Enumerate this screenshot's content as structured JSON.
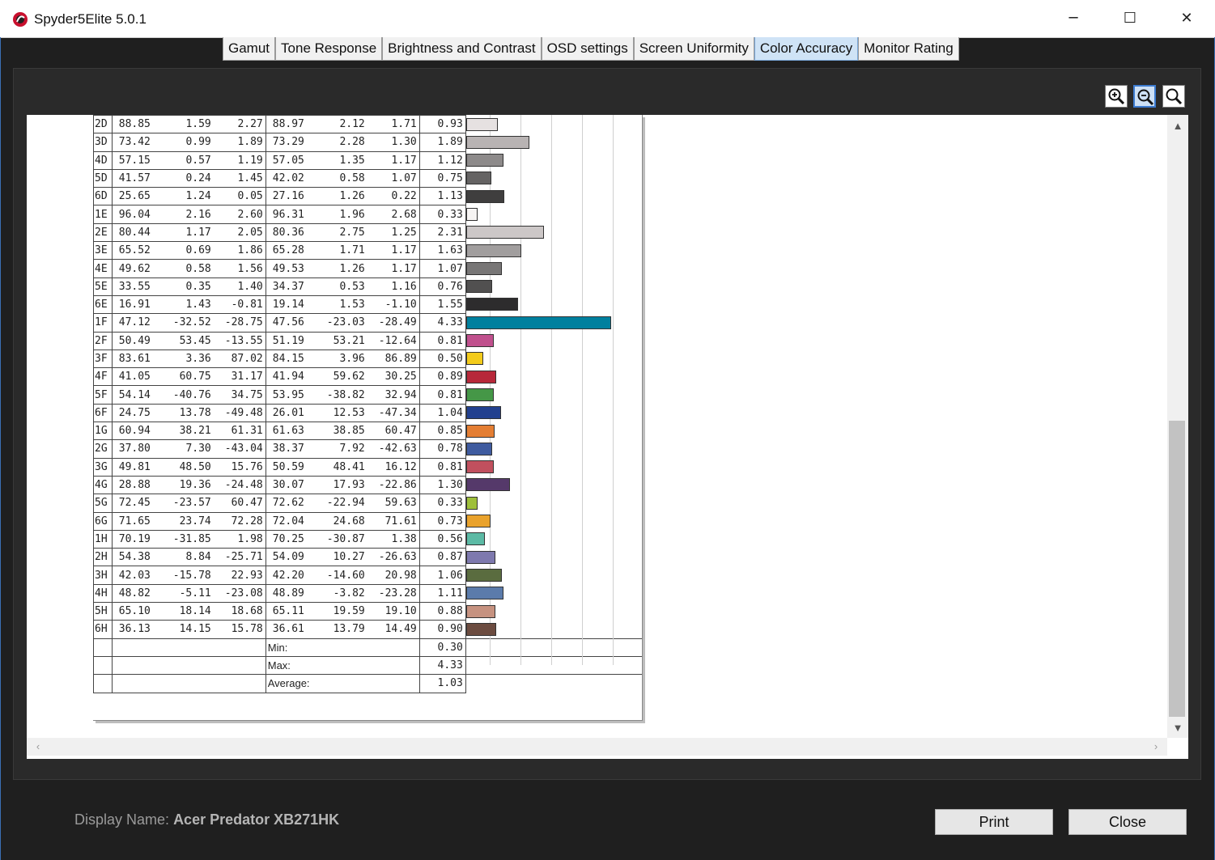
{
  "window": {
    "title": "Spyder5Elite 5.0.1",
    "minimize_glyph": "─",
    "maximize_glyph": "☐",
    "close_glyph": "✕",
    "accent_color": "#3b6fb5"
  },
  "tabs": [
    {
      "label": "Gamut",
      "active": false
    },
    {
      "label": "Tone Response",
      "active": false
    },
    {
      "label": "Brightness and Contrast",
      "active": false
    },
    {
      "label": "OSD settings",
      "active": false
    },
    {
      "label": "Screen Uniformity",
      "active": false
    },
    {
      "label": "Color Accuracy",
      "active": true
    },
    {
      "label": "Monitor Rating",
      "active": false
    }
  ],
  "zoom_tools": [
    {
      "icon": "zoom-in-icon"
    },
    {
      "icon": "zoom-out-icon",
      "selected": true
    },
    {
      "icon": "zoom-fit-icon"
    }
  ],
  "table": {
    "rows": [
      {
        "id": "2D",
        "ref": [
          "88.85",
          "1.59",
          "2.27"
        ],
        "meas": [
          "88.97",
          "2.12",
          "1.71"
        ],
        "de": "0.93",
        "color": "#e6e1e1"
      },
      {
        "id": "3D",
        "ref": [
          "73.42",
          "0.99",
          "1.89"
        ],
        "meas": [
          "73.29",
          "2.28",
          "1.30"
        ],
        "de": "1.89",
        "color": "#b8b3b3"
      },
      {
        "id": "4D",
        "ref": [
          "57.15",
          "0.57",
          "1.19"
        ],
        "meas": [
          "57.05",
          "1.35",
          "1.17"
        ],
        "de": "1.12",
        "color": "#8d8a8a"
      },
      {
        "id": "5D",
        "ref": [
          "41.57",
          "0.24",
          "1.45"
        ],
        "meas": [
          "42.02",
          "0.58",
          "1.07"
        ],
        "de": "0.75",
        "color": "#656363"
      },
      {
        "id": "6D",
        "ref": [
          "25.65",
          "1.24",
          "0.05"
        ],
        "meas": [
          "27.16",
          "1.26",
          "0.22"
        ],
        "de": "1.13",
        "color": "#3f3e3e"
      },
      {
        "id": "1E",
        "ref": [
          "96.04",
          "2.16",
          "2.60"
        ],
        "meas": [
          "96.31",
          "1.96",
          "2.68"
        ],
        "de": "0.33",
        "color": "#f6f4f3"
      },
      {
        "id": "2E",
        "ref": [
          "80.44",
          "1.17",
          "2.05"
        ],
        "meas": [
          "80.36",
          "2.75",
          "1.25"
        ],
        "de": "2.31",
        "color": "#ccc7c7"
      },
      {
        "id": "3E",
        "ref": [
          "65.52",
          "0.69",
          "1.86"
        ],
        "meas": [
          "65.28",
          "1.71",
          "1.17"
        ],
        "de": "1.63",
        "color": "#a19e9e"
      },
      {
        "id": "4E",
        "ref": [
          "49.62",
          "0.58",
          "1.56"
        ],
        "meas": [
          "49.53",
          "1.26",
          "1.17"
        ],
        "de": "1.07",
        "color": "#787676"
      },
      {
        "id": "5E",
        "ref": [
          "33.55",
          "0.35",
          "1.40"
        ],
        "meas": [
          "34.37",
          "0.53",
          "1.16"
        ],
        "de": "0.76",
        "color": "#515050"
      },
      {
        "id": "6E",
        "ref": [
          "16.91",
          "1.43",
          "-0.81"
        ],
        "meas": [
          "19.14",
          "1.53",
          "-1.10"
        ],
        "de": "1.55",
        "color": "#2d2c2d"
      },
      {
        "id": "1F",
        "ref": [
          "47.12",
          "-32.52",
          "-28.75"
        ],
        "meas": [
          "47.56",
          "-23.03",
          "-28.49"
        ],
        "de": "4.33",
        "color": "#00809e"
      },
      {
        "id": "2F",
        "ref": [
          "50.49",
          "53.45",
          "-13.55"
        ],
        "meas": [
          "51.19",
          "53.21",
          "-12.64"
        ],
        "de": "0.81",
        "color": "#c0508d"
      },
      {
        "id": "3F",
        "ref": [
          "83.61",
          "3.36",
          "87.02"
        ],
        "meas": [
          "84.15",
          "3.96",
          "86.89"
        ],
        "de": "0.50",
        "color": "#f3cb1b"
      },
      {
        "id": "4F",
        "ref": [
          "41.05",
          "60.75",
          "31.17"
        ],
        "meas": [
          "41.94",
          "59.62",
          "30.25"
        ],
        "de": "0.89",
        "color": "#b7283a"
      },
      {
        "id": "5F",
        "ref": [
          "54.14",
          "-40.76",
          "34.75"
        ],
        "meas": [
          "53.95",
          "-38.82",
          "32.94"
        ],
        "de": "0.81",
        "color": "#459747"
      },
      {
        "id": "6F",
        "ref": [
          "24.75",
          "13.78",
          "-49.48"
        ],
        "meas": [
          "26.01",
          "12.53",
          "-47.34"
        ],
        "de": "1.04",
        "color": "#22408f"
      },
      {
        "id": "1G",
        "ref": [
          "60.94",
          "38.21",
          "61.31"
        ],
        "meas": [
          "61.63",
          "38.85",
          "60.47"
        ],
        "de": "0.85",
        "color": "#e47e33"
      },
      {
        "id": "2G",
        "ref": [
          "37.80",
          "7.30",
          "-43.04"
        ],
        "meas": [
          "38.37",
          "7.92",
          "-42.63"
        ],
        "de": "0.78",
        "color": "#3f5b9f"
      },
      {
        "id": "3G",
        "ref": [
          "49.81",
          "48.50",
          "15.76"
        ],
        "meas": [
          "50.59",
          "48.41",
          "16.12"
        ],
        "de": "0.81",
        "color": "#c1505e"
      },
      {
        "id": "4G",
        "ref": [
          "28.88",
          "19.36",
          "-24.48"
        ],
        "meas": [
          "30.07",
          "17.93",
          "-22.86"
        ],
        "de": "1.30",
        "color": "#55396a"
      },
      {
        "id": "5G",
        "ref": [
          "72.45",
          "-23.57",
          "60.47"
        ],
        "meas": [
          "72.62",
          "-22.94",
          "59.63"
        ],
        "de": "0.33",
        "color": "#9ebf3b"
      },
      {
        "id": "6G",
        "ref": [
          "71.65",
          "23.74",
          "72.28"
        ],
        "meas": [
          "72.04",
          "24.68",
          "71.61"
        ],
        "de": "0.73",
        "color": "#e9a22c"
      },
      {
        "id": "1H",
        "ref": [
          "70.19",
          "-31.85",
          "1.98"
        ],
        "meas": [
          "70.25",
          "-30.87",
          "1.38"
        ],
        "de": "0.56",
        "color": "#5cbaa5"
      },
      {
        "id": "2H",
        "ref": [
          "54.38",
          "8.84",
          "-25.71"
        ],
        "meas": [
          "54.09",
          "10.27",
          "-26.63"
        ],
        "de": "0.87",
        "color": "#7e79ae"
      },
      {
        "id": "3H",
        "ref": [
          "42.03",
          "-15.78",
          "22.93"
        ],
        "meas": [
          "42.20",
          "-14.60",
          "20.98"
        ],
        "de": "1.06",
        "color": "#5a6c3f"
      },
      {
        "id": "4H",
        "ref": [
          "48.82",
          "-5.11",
          "-23.08"
        ],
        "meas": [
          "48.89",
          "-3.82",
          "-23.28"
        ],
        "de": "1.11",
        "color": "#5b7bab"
      },
      {
        "id": "5H",
        "ref": [
          "65.10",
          "18.14",
          "18.68"
        ],
        "meas": [
          "65.11",
          "19.59",
          "19.10"
        ],
        "de": "0.88",
        "color": "#c69280"
      },
      {
        "id": "6H",
        "ref": [
          "36.13",
          "14.15",
          "15.78"
        ],
        "meas": [
          "36.61",
          "13.79",
          "14.49"
        ],
        "de": "0.90",
        "color": "#6c4c40"
      }
    ],
    "summary": [
      {
        "label": "Min:",
        "value": "0.30"
      },
      {
        "label": "Max:",
        "value": "4.33"
      },
      {
        "label": "Average:",
        "value": "1.03"
      }
    ],
    "bar_scale_max": 5.5
  },
  "footer": {
    "display_name_label": "Display Name:",
    "display_name_value": "Acer Predator XB271HK",
    "print_label": "Print",
    "close_label": "Close"
  }
}
